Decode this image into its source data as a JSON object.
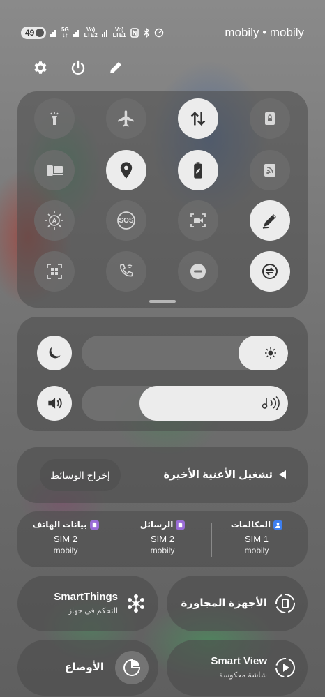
{
  "status_bar": {
    "battery": "49",
    "net1_top": "5G",
    "net1_bottom": "",
    "net2_top": "Vo)",
    "net2_bottom": "LTE2",
    "net3_top": "Vo)",
    "net3_bottom": "LTE1",
    "carrier": "mobily • mobily"
  },
  "quick_tiles": [
    {
      "icon": "flashlight-icon",
      "state": "off"
    },
    {
      "icon": "airplane-icon",
      "state": "off"
    },
    {
      "icon": "mobile-data-icon",
      "state": "on"
    },
    {
      "icon": "lock-icon",
      "state": "off"
    },
    {
      "icon": "link-to-windows-icon",
      "state": "off"
    },
    {
      "icon": "location-icon",
      "state": "on"
    },
    {
      "icon": "power-saving-icon",
      "state": "on"
    },
    {
      "icon": "cast-icon",
      "state": "off"
    },
    {
      "icon": "auto-brightness-icon",
      "state": "off"
    },
    {
      "icon": "sos-icon",
      "state": "off"
    },
    {
      "icon": "screen-recorder-icon",
      "state": "off"
    },
    {
      "icon": "pen-icon",
      "state": "on"
    },
    {
      "icon": "qr-scanner-icon",
      "state": "off"
    },
    {
      "icon": "wifi-calling-icon",
      "state": "off"
    },
    {
      "icon": "do-not-disturb-icon",
      "state": "off"
    },
    {
      "icon": "sync-icon",
      "state": "on"
    }
  ],
  "sos_label": "SOS",
  "sliders": {
    "brightness_level": 0.24,
    "volume_level": 0.72
  },
  "media": {
    "output_label": "إخراج الوسائط",
    "play_label": "تشغيل الأغنية الأخيرة"
  },
  "sim": [
    {
      "title": "المكالمات",
      "sim": "SIM 1",
      "operator": "mobily",
      "badge_color": "#3d7ff0"
    },
    {
      "title": "الرسائل",
      "sim": "SIM 2",
      "operator": "mobily",
      "badge_color": "#9a6cd6"
    },
    {
      "title": "بيانات الهاتف",
      "sim": "SIM 2",
      "operator": "mobily",
      "badge_color": "#9a6cd6"
    }
  ],
  "cards": {
    "nearby_title": "الأجهزة المجاورة",
    "smartthings_title": "SmartThings",
    "smartthings_sub": "التحكم في جهاز",
    "smartview_title": "Smart View",
    "smartview_sub": "شاشة معكوسة",
    "modes_title": "الأوضاع"
  },
  "colors": {
    "tile_on": "#ececec",
    "tile_off": "#6e6e6e",
    "panel": "#4b4b4b"
  }
}
